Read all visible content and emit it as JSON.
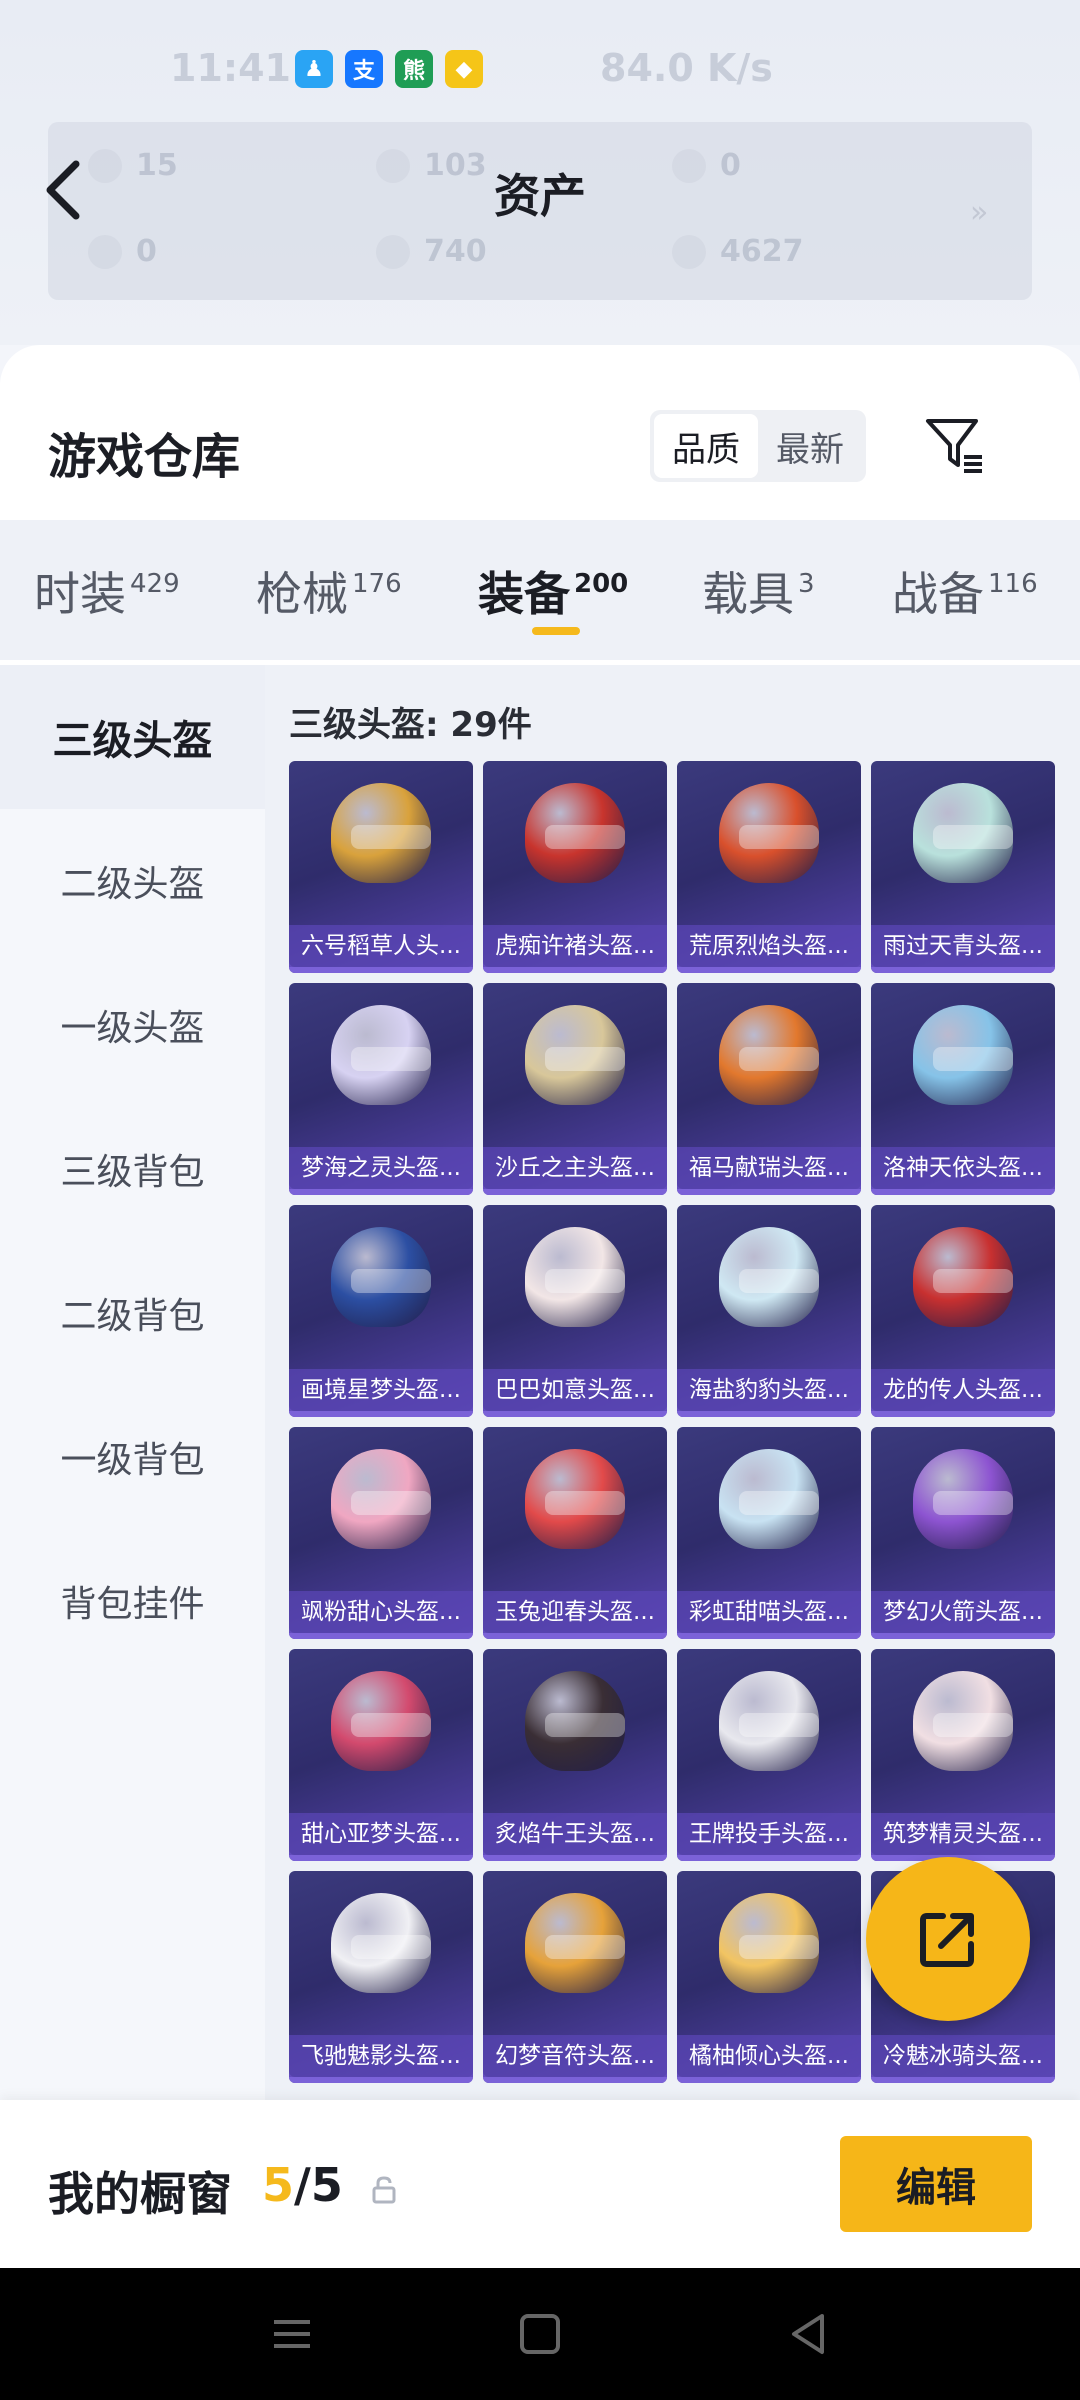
{
  "status_bar": {
    "time": "11:41",
    "right_text": "84.0 K/s",
    "icons": [
      {
        "name": "qq-icon",
        "color": "#2aa4f4",
        "glyph": "♟"
      },
      {
        "name": "alipay-icon",
        "color": "#1677ff",
        "glyph": "支"
      },
      {
        "name": "panda-app-icon",
        "color": "#1f9d55",
        "glyph": "熊"
      },
      {
        "name": "diamond-app-icon",
        "color": "#f5c518",
        "glyph": "◆"
      }
    ]
  },
  "assets": {
    "title": "资产",
    "values": [
      "15",
      "103",
      "0",
      "0",
      "740",
      "4627"
    ]
  },
  "sheet": {
    "title": "游戏仓库",
    "quality_label": "品质",
    "latest_label": "最新"
  },
  "tabs": [
    {
      "label": "时装",
      "count": "429"
    },
    {
      "label": "枪械",
      "count": "176"
    },
    {
      "label": "装备",
      "count": "200"
    },
    {
      "label": "载具",
      "count": "3"
    },
    {
      "label": "战备",
      "count": "116"
    }
  ],
  "sidebar": [
    "三级头盔",
    "二级头盔",
    "一级头盔",
    "三级背包",
    "二级背包",
    "一级背包",
    "背包挂件"
  ],
  "grid_title": "三级头盔: 29件",
  "items": [
    {
      "label": "六号稻草人头...",
      "color": "#d9a23c"
    },
    {
      "label": "虎痴许褚头盔...",
      "color": "#c8342d"
    },
    {
      "label": "荒原烈焰头盔...",
      "color": "#d9502c"
    },
    {
      "label": "雨过天青头盔...",
      "color": "#b9e1dc"
    },
    {
      "label": "梦海之灵头盔...",
      "color": "#d7d2f2"
    },
    {
      "label": "沙丘之主头盔...",
      "color": "#d8c79a"
    },
    {
      "label": "福马献瑞头盔...",
      "color": "#e2782d"
    },
    {
      "label": "洛神天依头盔...",
      "color": "#86c3e8"
    },
    {
      "label": "画境星梦头盔...",
      "color": "#2c4fa3"
    },
    {
      "label": "巴巴如意头盔...",
      "color": "#f2e6e6"
    },
    {
      "label": "海盐豹豹头盔...",
      "color": "#cfe8f3"
    },
    {
      "label": "龙的传人头盔...",
      "color": "#c83030"
    },
    {
      "label": "飒粉甜心头盔...",
      "color": "#f0a7c2"
    },
    {
      "label": "玉兔迎春头盔...",
      "color": "#e24a4a"
    },
    {
      "label": "彩虹甜喵头盔...",
      "color": "#c8e2f2"
    },
    {
      "label": "梦幻火箭头盔...",
      "color": "#8d54d1"
    },
    {
      "label": "甜心亚梦头盔...",
      "color": "#d34a6e"
    },
    {
      "label": "炙焰牛王头盔...",
      "color": "#3a2e35"
    },
    {
      "label": "王牌投手头盔...",
      "color": "#e8e8ee"
    },
    {
      "label": "筑梦精灵头盔...",
      "color": "#f1dfe3"
    },
    {
      "label": "飞驰魅影头盔...",
      "color": "#f0f0f4"
    },
    {
      "label": "幻梦音符头盔...",
      "color": "#e6a23a"
    },
    {
      "label": "橘柚倾心头盔...",
      "color": "#f2c462"
    },
    {
      "label": "冷魅冰骑头盔...",
      "color": "#9fd0e8"
    }
  ],
  "showcase": {
    "label": "我的橱窗",
    "current": "5",
    "total": "/5",
    "edit_label": "编辑"
  }
}
